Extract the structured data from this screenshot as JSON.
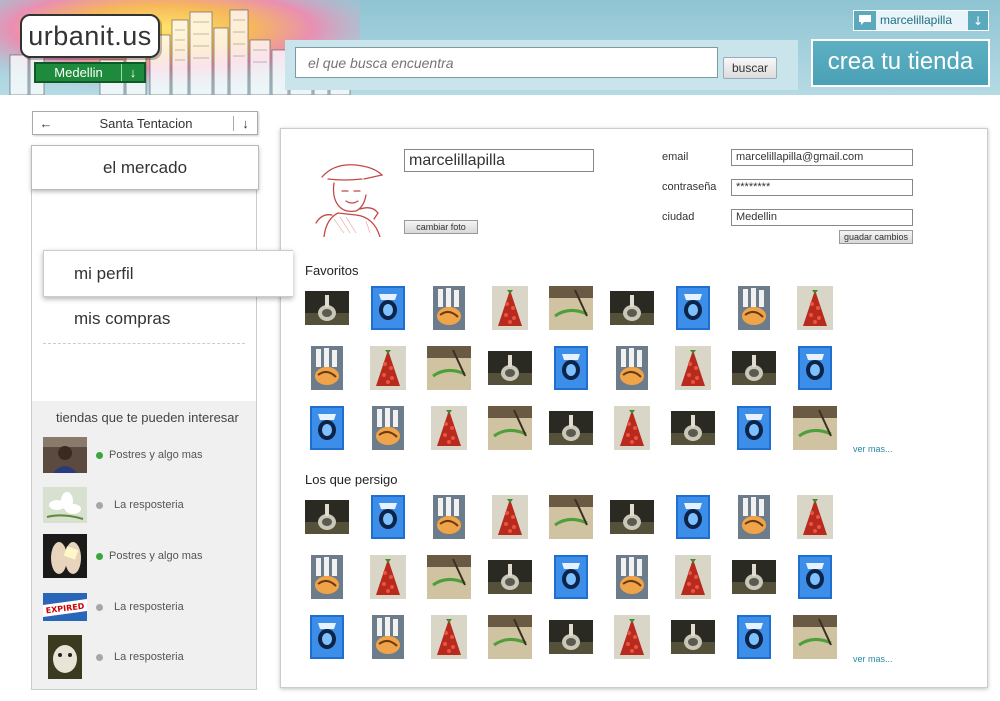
{
  "header": {
    "logo_text": "urbanit.us",
    "city": "Medellin",
    "search_placeholder": "el que busca encuentra",
    "search_button": "buscar",
    "create_store_button": "crea tu tienda",
    "username": "marcelillapilla"
  },
  "sidebar": {
    "store_select": "Santa Tentacion",
    "nav": {
      "market": "el mercado",
      "profile": "mi perfil",
      "purchases": "mis compras"
    },
    "suggestions_title": "tiendas que te pueden interesar",
    "suggestions": [
      {
        "label": "Postres y algo mas",
        "status": "online",
        "thumb": "person-photo"
      },
      {
        "label": "La resposteria",
        "status": "offline",
        "thumb": "flower-photo"
      },
      {
        "label": "Postres y algo mas",
        "status": "online",
        "thumb": "feet-photo"
      },
      {
        "label": "La resposteria",
        "status": "offline",
        "thumb": "expired-sign-photo"
      },
      {
        "label": "La resposteria",
        "status": "offline",
        "thumb": "dog-photo"
      }
    ],
    "status_colors": {
      "online": "#3aa53a",
      "offline": "#a6a6a6"
    }
  },
  "profile": {
    "name": "marcelillapilla",
    "change_photo_button": "cambiar foto",
    "fields": {
      "email_label": "email",
      "email_value": "marcelillapilla@gmail.com",
      "password_label": "contraseña",
      "password_value": "********",
      "city_label": "ciudad",
      "city_value": "Medellin"
    },
    "save_button": "guadar cambios"
  },
  "favorites": {
    "title": "Favoritos",
    "see_more": "ver mas...",
    "rows": [
      [
        "glass",
        "blue",
        "bottles",
        "strawberry",
        "slice",
        "glass",
        "blue",
        "bottles",
        "strawberry"
      ],
      [
        "bottles",
        "strawberry",
        "slice",
        "glass",
        "blue",
        "bottles",
        "strawberry",
        "glass",
        "blue"
      ],
      [
        "blue",
        "bottles",
        "strawberry",
        "slice",
        "glass",
        "strawberry",
        "glass",
        "blue",
        "slice"
      ]
    ]
  },
  "following": {
    "title": "Los que persigo",
    "see_more": "ver mas...",
    "rows": [
      [
        "glass",
        "blue",
        "bottles",
        "strawberry",
        "slice",
        "glass",
        "blue",
        "bottles",
        "strawberry"
      ],
      [
        "bottles",
        "strawberry",
        "slice",
        "glass",
        "blue",
        "bottles",
        "strawberry",
        "glass",
        "blue"
      ],
      [
        "blue",
        "bottles",
        "strawberry",
        "slice",
        "glass",
        "strawberry",
        "glass",
        "blue",
        "slice"
      ]
    ]
  },
  "colors": {
    "header_bg": "#9fcfdb",
    "accent": "#4aa0b5",
    "city_green": "#1e8a3c",
    "link": "#2a88a6"
  }
}
